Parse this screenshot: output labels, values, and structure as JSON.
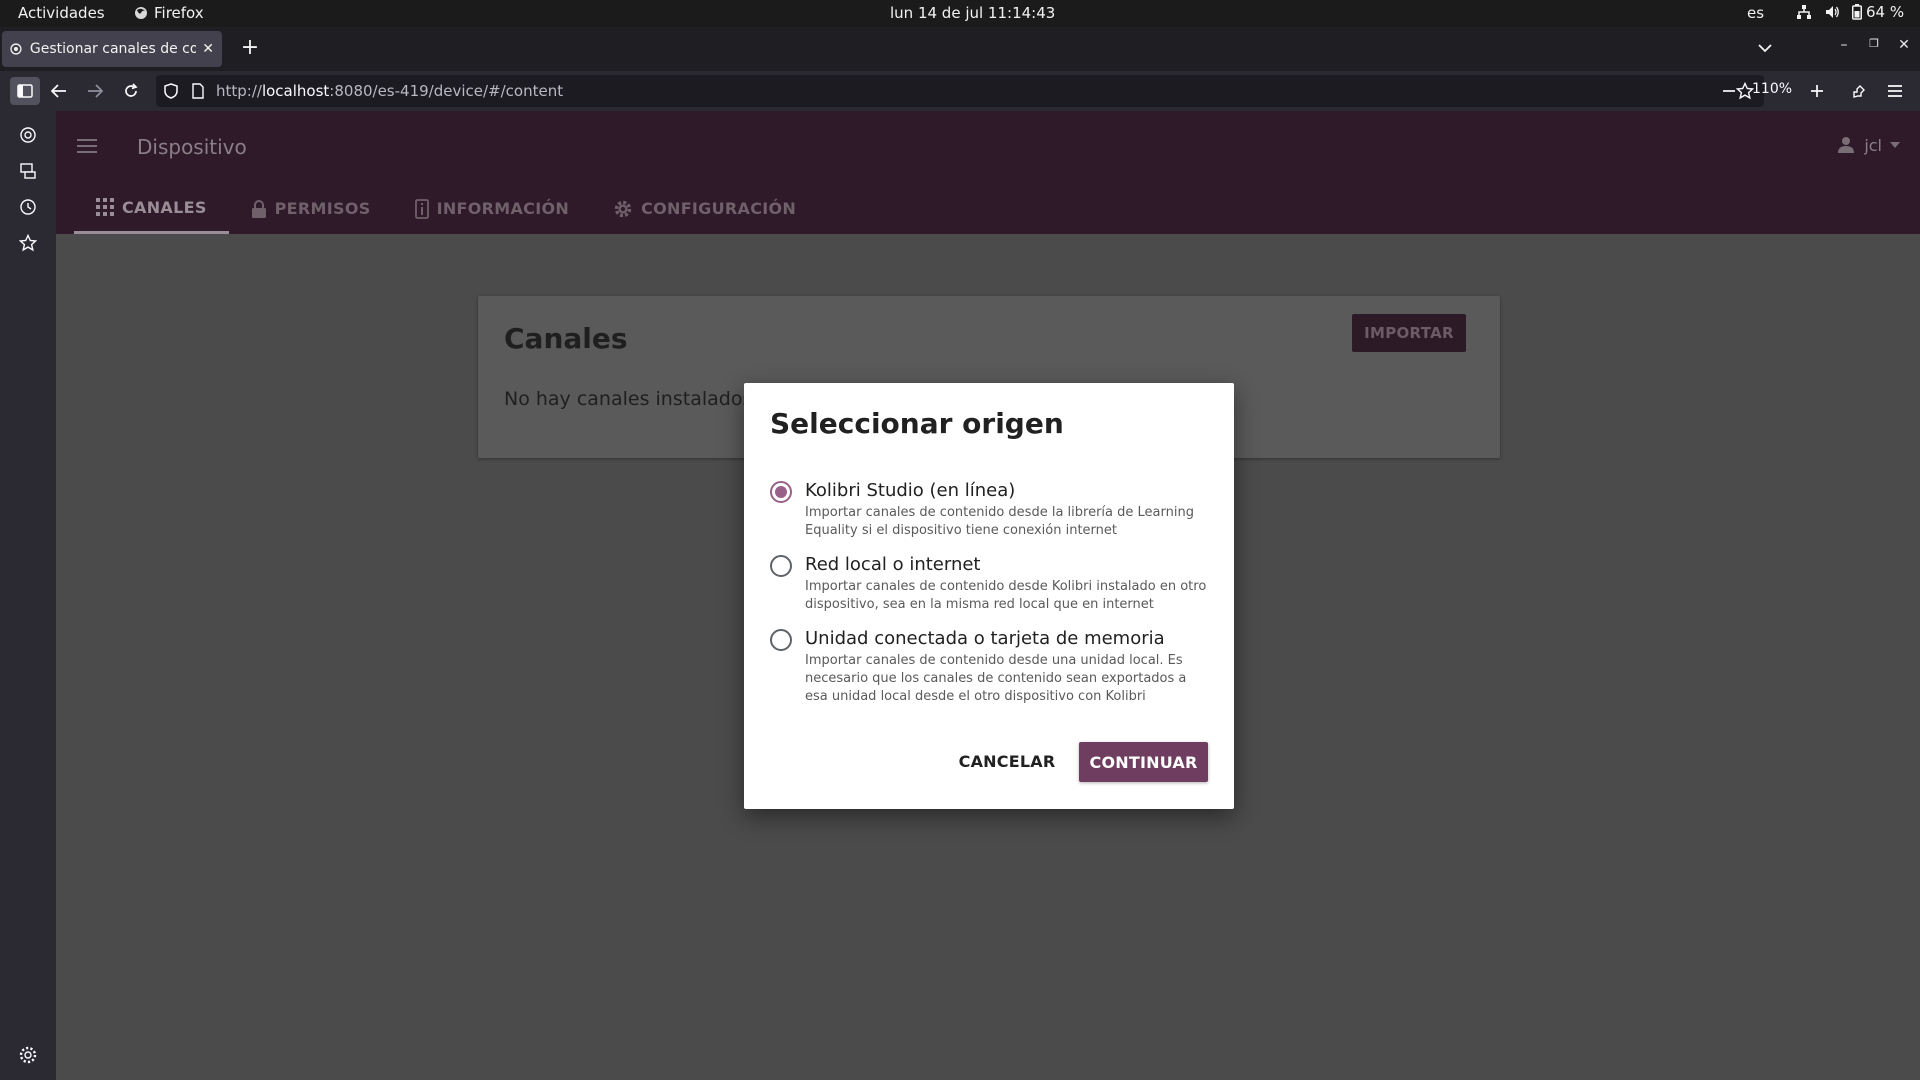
{
  "system_bar": {
    "activities": "Actividades",
    "app_name": "Firefox",
    "clock": "lun 14 de jul  11:14:43",
    "language": "es",
    "battery": "64 %"
  },
  "browser": {
    "tab_title": "Gestionar canales de con",
    "url_host": "localhost",
    "url_prefix": "http://",
    "url_rest": ":8080/es-419/device/#/content",
    "zoom": "110%"
  },
  "app": {
    "title": "Dispositivo",
    "user": "jcl",
    "tabs": [
      {
        "label": "CANALES",
        "icon": "apps-icon",
        "active": true
      },
      {
        "label": "PERMISOS",
        "icon": "lock-icon",
        "active": false
      },
      {
        "label": "INFORMACIÓN",
        "icon": "info-icon",
        "active": false
      },
      {
        "label": "CONFIGURACIÓN",
        "icon": "gear-icon",
        "active": false
      }
    ]
  },
  "channels_card": {
    "title": "Canales",
    "import_label": "IMPORTAR",
    "empty_message": "No hay canales instalados"
  },
  "modal": {
    "title": "Seleccionar origen",
    "options": [
      {
        "label": "Kolibri Studio (en línea)",
        "description": "Importar canales de contenido desde la librería de Learning Equality si el dispositivo tiene conexión internet",
        "selected": true
      },
      {
        "label": "Red local o internet",
        "description": "Importar canales de contenido desde Kolibri instalado en otro dispositivo, sea en la misma red local que en internet",
        "selected": false
      },
      {
        "label": "Unidad conectada o tarjeta de memoria",
        "description": "Importar canales de contenido desde una unidad local. Es necesario que los canales de contenido sean exportados a esa unidad local desde el otro dispositivo con Kolibri",
        "selected": false
      }
    ],
    "cancel_label": "CANCELAR",
    "continue_label": "CONTINUAR"
  },
  "colors": {
    "brand": "#6e3d5f",
    "radio_selected": "#996189"
  }
}
